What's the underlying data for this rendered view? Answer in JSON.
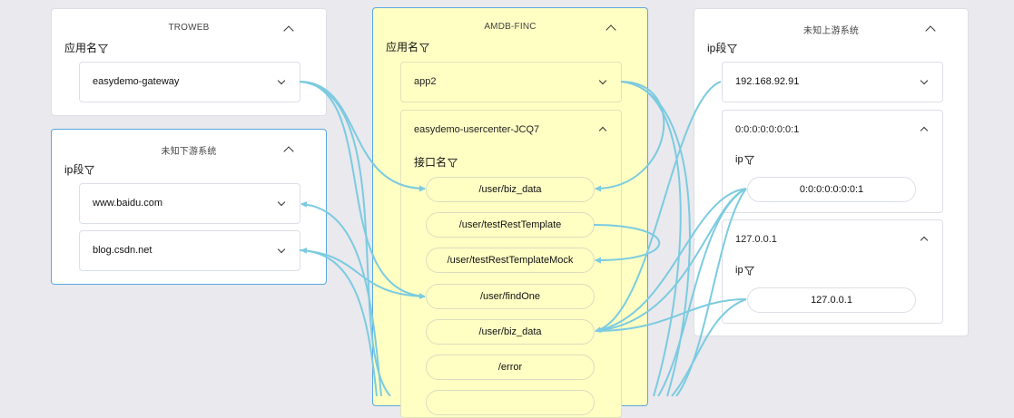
{
  "panels": {
    "troweb": {
      "title": "TROWEB",
      "filter_label": "应用名",
      "items": [
        "easydemo-gateway"
      ]
    },
    "downstream": {
      "title": "未知下游系统",
      "filter_label": "ip段",
      "items": [
        "www.baidu.com",
        "blog.csdn.net"
      ]
    },
    "amdb": {
      "title": "AMDB-FINC",
      "filter_label": "应用名",
      "app_item": "app2",
      "service": {
        "name": "easydemo-usercenter-JCQ7",
        "filter_label": "接口名",
        "interfaces": [
          "/user/biz_data",
          "/user/testRestTemplate",
          "/user/testRestTemplateMock",
          "/user/findOne",
          "/user/biz_data",
          "/error"
        ]
      }
    },
    "upstream": {
      "title": "未知上游系统",
      "filter_label": "ip段",
      "ip_item": "192.168.92.91",
      "groups": [
        {
          "name": "0:0:0:0:0:0:0:1",
          "filter_label": "ip",
          "entries": [
            "0:0:0:0:0:0:0:1"
          ]
        },
        {
          "name": "127.0.0.1",
          "filter_label": "ip",
          "entries": [
            "127.0.0.1"
          ]
        }
      ]
    }
  },
  "colors": {
    "link": "#7ccbe0",
    "highlight_border": "#5aa8e0",
    "active_panel_bg": "#ffffc4"
  }
}
